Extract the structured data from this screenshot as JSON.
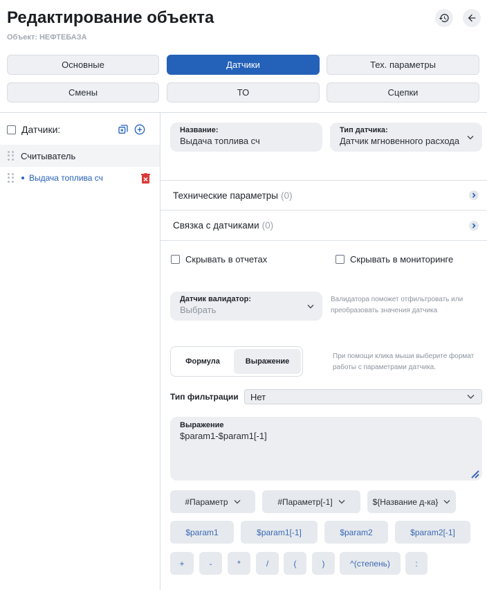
{
  "header": {
    "title": "Редактирование объекта",
    "subtitle_prefix": "Объект:",
    "subtitle_value": "НЕФТЕБАЗА"
  },
  "tabs": [
    {
      "label": "Основные",
      "active": false
    },
    {
      "label": "Датчики",
      "active": true
    },
    {
      "label": "Тех. параметры",
      "active": false
    },
    {
      "label": "Смены",
      "active": false
    },
    {
      "label": "ТО",
      "active": false
    },
    {
      "label": "Сцепки",
      "active": false
    }
  ],
  "sidebar": {
    "header_label": "Датчики:",
    "items": [
      {
        "label": "Считыватель"
      },
      {
        "label": "Выдача топлива сч"
      }
    ]
  },
  "form": {
    "name_label": "Название:",
    "name_value": "Выдача топлива сч",
    "type_label": "Тип датчика:",
    "type_value": "Датчик мгновенного расхода",
    "tech_params_label": "Технические параметры",
    "tech_params_count": "(0)",
    "sensor_links_label": "Связка с датчиками",
    "sensor_links_count": "(0)",
    "hide_reports_label": "Скрывать в отчетах",
    "hide_monitoring_label": "Скрывать в мониторинге",
    "validator_label": "Датчик валидатор:",
    "validator_placeholder": "Выбрать",
    "validator_hint_1": "Валидатора поможет отфильтровать или",
    "validator_hint_2": "преобразовать значения датчика",
    "formula_tab": "Формула",
    "expression_tab": "Выражение",
    "mode_hint_1": "При помощи клика мыши выберите формат",
    "mode_hint_2": "работы с параметрами датчика.",
    "filter_label": "Тип фильтрации",
    "filter_value": "Нет",
    "expression_label": "Выражение",
    "expression_value": "$param1-$param1[-1]"
  },
  "param_dropdowns": [
    {
      "label": "#Параметр"
    },
    {
      "label": "#Параметр[-1]"
    },
    {
      "label": "${Название д-ка}"
    }
  ],
  "param_buttons": [
    "$param1",
    "$param1[-1]",
    "$param2",
    "$param2[-1]"
  ],
  "operators": [
    "+",
    "-",
    "*",
    "/",
    "(",
    ")",
    "^(степень)",
    ":"
  ],
  "colors": {
    "accent": "#2461b8",
    "link_blue": "#3a69b5",
    "delete_red": "#d93a3a",
    "field_bg": "#eceef1"
  }
}
